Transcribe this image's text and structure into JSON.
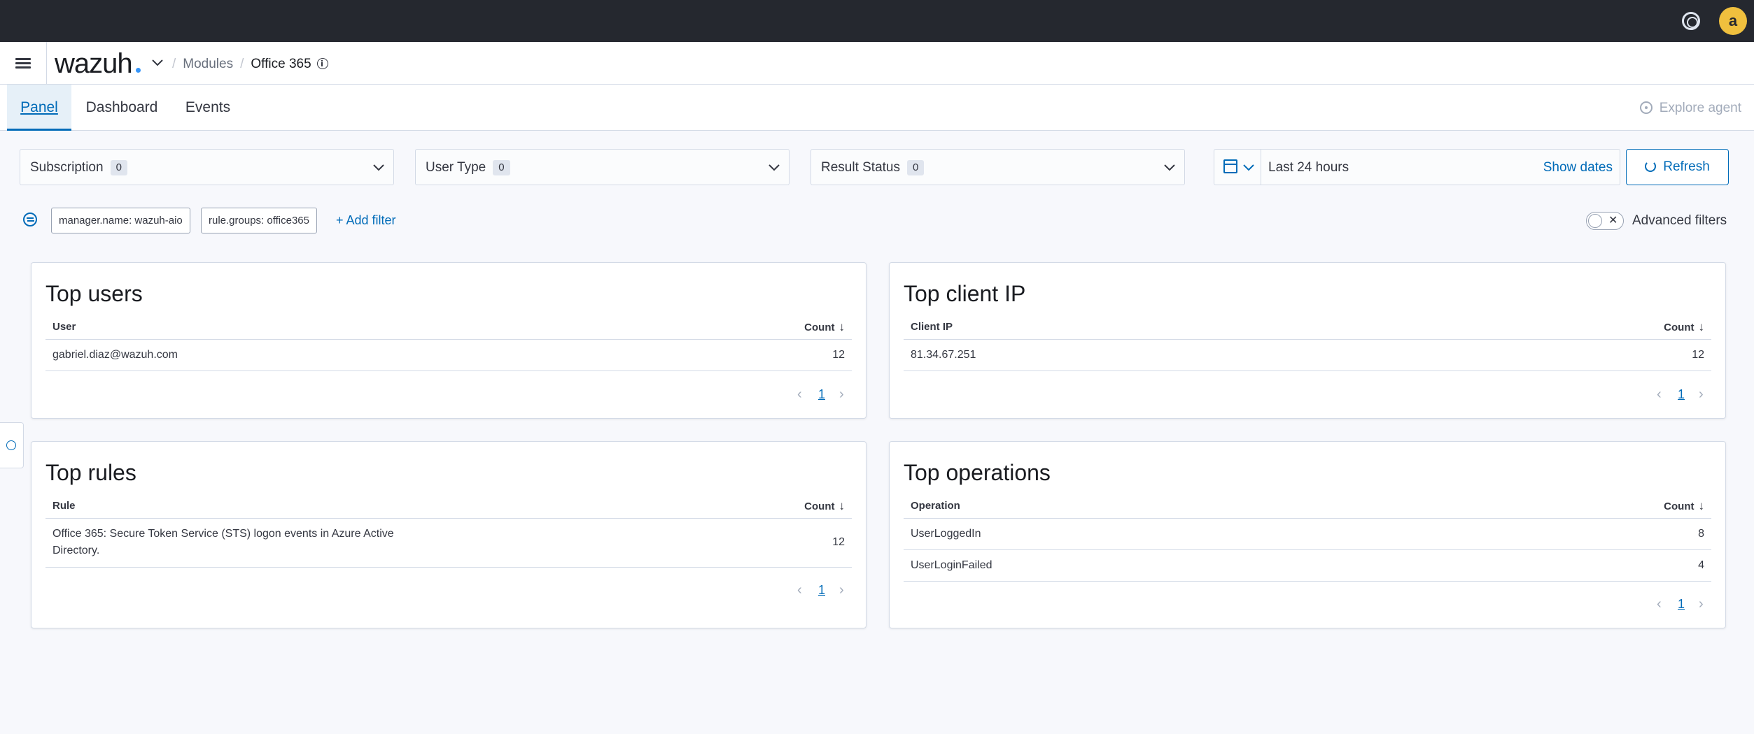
{
  "header": {
    "logo_text": "wazuh",
    "avatar_letter": "a",
    "breadcrumb": {
      "separator": "/",
      "module": "Modules",
      "current": "Office 365"
    }
  },
  "tabs": [
    {
      "label": "Panel",
      "active": true
    },
    {
      "label": "Dashboard",
      "active": false
    },
    {
      "label": "Events",
      "active": false
    }
  ],
  "explore_agent": "Explore agent",
  "controls": {
    "subscription": {
      "label": "Subscription",
      "count": "0"
    },
    "user_type": {
      "label": "User Type",
      "count": "0"
    },
    "result_status": {
      "label": "Result Status",
      "count": "0"
    },
    "time_range": "Last 24 hours",
    "show_dates": "Show dates",
    "refresh": "Refresh"
  },
  "filters": {
    "pills": [
      "manager.name: wazuh-aio",
      "rule.groups: office365"
    ],
    "add_filter": "+ Add filter",
    "advanced_label": "Advanced filters",
    "advanced_enabled": false
  },
  "panels": {
    "top_users": {
      "title": "Top users",
      "col1": "User",
      "col2": "Count",
      "rows": [
        {
          "name": "gabriel.diaz@wazuh.com",
          "count": "12"
        }
      ],
      "page": "1"
    },
    "top_client_ip": {
      "title": "Top client IP",
      "col1": "Client IP",
      "col2": "Count",
      "rows": [
        {
          "name": "81.34.67.251",
          "count": "12"
        }
      ],
      "page": "1"
    },
    "top_rules": {
      "title": "Top rules",
      "col1": "Rule",
      "col2": "Count",
      "rows": [
        {
          "name_line1": "Office 365: Secure Token Service (STS) logon events in Azure Active",
          "name_line2": "Directory.",
          "count": "12"
        }
      ],
      "page": "1"
    },
    "top_operations": {
      "title": "Top operations",
      "col1": "Operation",
      "col2": "Count",
      "rows": [
        {
          "name": "UserLoggedIn",
          "count": "8"
        },
        {
          "name": "UserLoginFailed",
          "count": "4"
        }
      ],
      "page": "1"
    }
  },
  "colors": {
    "accent": "#006bb8",
    "topbar": "#25282f",
    "avatar": "#f0c03e"
  }
}
